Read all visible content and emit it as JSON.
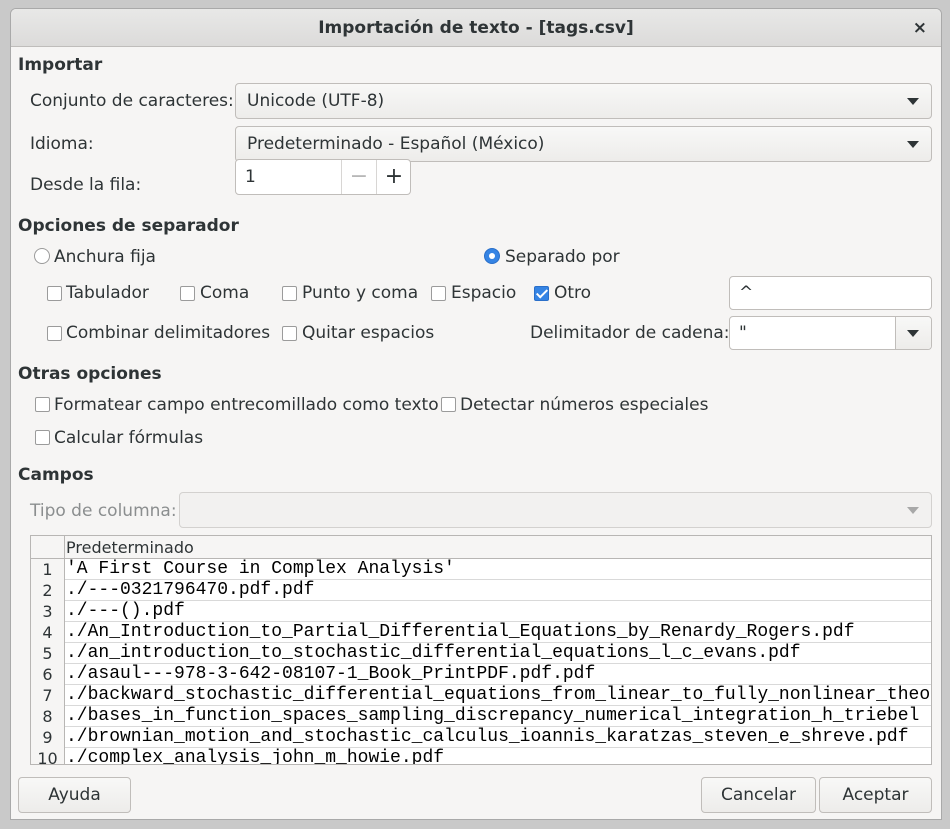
{
  "window": {
    "title": "Importación de texto - [tags.csv]",
    "close": "×"
  },
  "import": {
    "heading": "Importar",
    "charset_label": "Conjunto de caracteres:",
    "charset_value": "Unicode (UTF-8)",
    "language_label": "Idioma:",
    "language_value": "Predeterminado - Español (México)",
    "from_row_label": "Desde la fila:",
    "from_row_value": "1",
    "minus": "−",
    "plus": "+"
  },
  "separator": {
    "heading": "Opciones de separador",
    "fixed_width": "Anchura fija",
    "separated_by": "Separado por",
    "tab": "Tabulador",
    "comma": "Coma",
    "semicolon": "Punto y coma",
    "space": "Espacio",
    "other": "Otro",
    "other_value": "^",
    "merge_delimiters": "Combinar delimitadores",
    "trim_spaces": "Quitar espacios",
    "string_delimiter_label": "Delimitador de cadena:",
    "string_delimiter_value": "\""
  },
  "other_options": {
    "heading": "Otras opciones",
    "quoted_as_text": "Formatear campo entrecomillado como texto",
    "detect_special_numbers": "Detectar números especiales",
    "evaluate_formulas": "Calcular fórmulas"
  },
  "fields": {
    "heading": "Campos",
    "column_type_label": "Tipo de columna:",
    "column_header": "Predeterminado",
    "rows": [
      {
        "num": "1",
        "value": "'A First Course in Complex Analysis'"
      },
      {
        "num": "2",
        "value": "./---0321796470.pdf.pdf"
      },
      {
        "num": "3",
        "value": "./---().pdf"
      },
      {
        "num": "4",
        "value": "./An_Introduction_to_Partial_Differential_Equations_by_Renardy_Rogers.pdf"
      },
      {
        "num": "5",
        "value": "./an_introduction_to_stochastic_differential_equations_l_c_evans.pdf"
      },
      {
        "num": "6",
        "value": "./asaul---978-3-642-08107-1_Book_PrintPDF.pdf.pdf"
      },
      {
        "num": "7",
        "value": "./backward_stochastic_differential_equations_from_linear_to_fully_nonlinear_theory"
      },
      {
        "num": "8",
        "value": "./bases_in_function_spaces_sampling_discrepancy_numerical_integration_h_triebel"
      },
      {
        "num": "9",
        "value": "./brownian_motion_and_stochastic_calculus_ioannis_karatzas_steven_e_shreve.pdf"
      },
      {
        "num": "10",
        "value": "./complex_analysis_john_m_howie.pdf"
      }
    ]
  },
  "buttons": {
    "help": "Ayuda",
    "cancel": "Cancelar",
    "accept": "Aceptar"
  }
}
